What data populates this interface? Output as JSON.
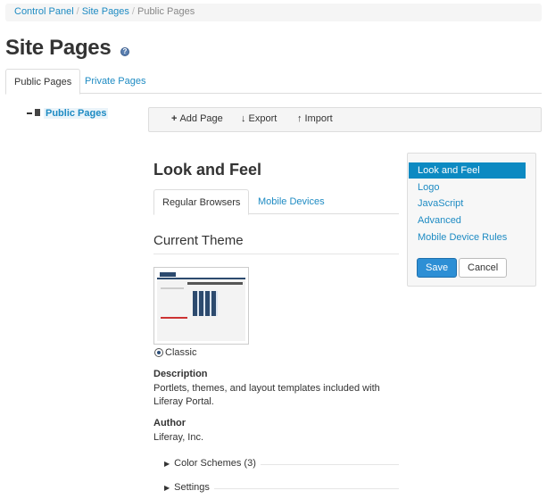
{
  "breadcrumb": {
    "items": [
      "Control Panel",
      "Site Pages",
      "Public Pages"
    ]
  },
  "page": {
    "title": "Site Pages"
  },
  "top_tabs": [
    "Public Pages",
    "Private Pages"
  ],
  "tree": {
    "root_label": "Public Pages"
  },
  "toolbar": {
    "add_page": "Add Page",
    "export": "Export",
    "import": "Import"
  },
  "look_and_feel": {
    "title": "Look and Feel",
    "tabs": [
      "Regular Browsers",
      "Mobile Devices"
    ],
    "current_theme_title": "Current Theme",
    "theme_name": "Classic",
    "description_label": "Description",
    "description_line1": "Portlets, themes, and layout templates included with",
    "description_line2": "Liferay Portal.",
    "author_label": "Author",
    "author_name": "Liferay, Inc.",
    "color_schemes": "Color Schemes (3)",
    "settings": "Settings"
  },
  "side_menu": {
    "items": [
      "Look and Feel",
      "Logo",
      "JavaScript",
      "Advanced",
      "Mobile Device Rules"
    ],
    "save": "Save",
    "cancel": "Cancel"
  },
  "colors": {
    "link": "#1e8bc3",
    "active_menu": "#0c8ac2",
    "primary_button": "#2d8fd5"
  }
}
